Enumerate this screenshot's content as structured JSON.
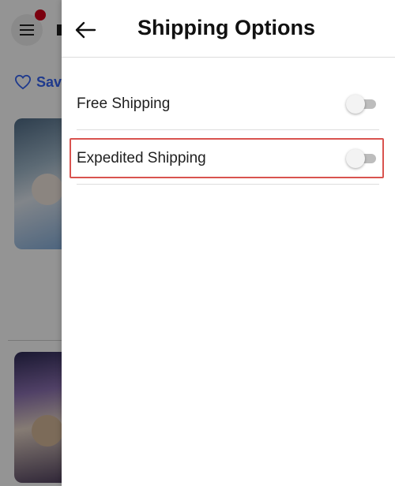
{
  "background": {
    "save_label": "Sav",
    "notification_color": "#d4001a"
  },
  "panel": {
    "title": "Shipping Options",
    "back_icon": "arrow-left-icon",
    "options": [
      {
        "label": "Free Shipping",
        "enabled": false
      },
      {
        "label": "Expedited Shipping",
        "enabled": false,
        "highlighted": true
      }
    ]
  },
  "colors": {
    "accent": "#3665f3",
    "highlight_border": "#d9534f"
  }
}
